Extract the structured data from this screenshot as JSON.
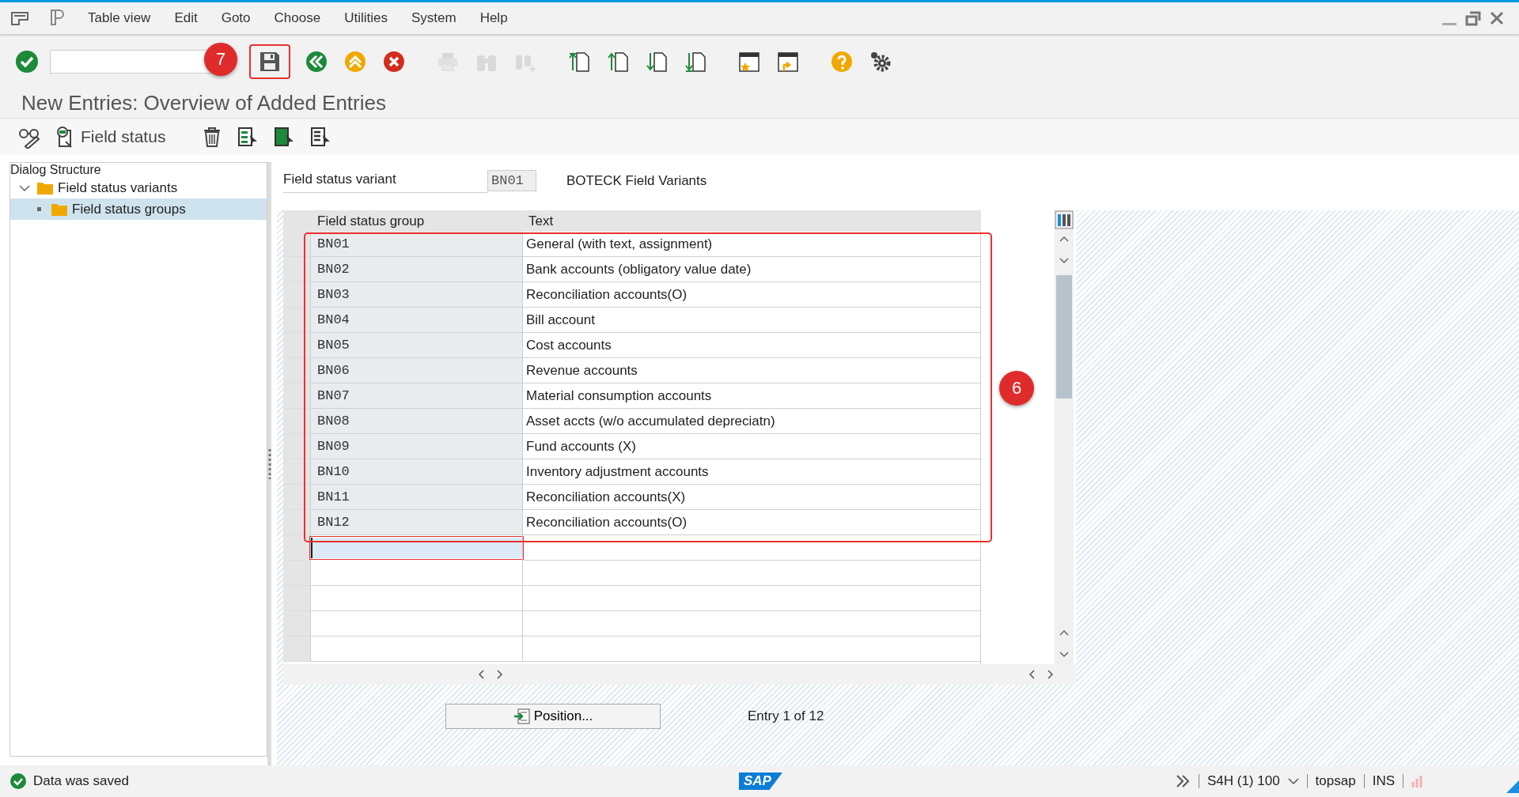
{
  "menu_bar": {
    "items": [
      {
        "label": "Table view"
      },
      {
        "label": "Edit"
      },
      {
        "label": "Goto"
      },
      {
        "label": "Choose"
      },
      {
        "label": "Utilities"
      },
      {
        "label": "System"
      },
      {
        "label": "Help"
      }
    ]
  },
  "toolbar": {
    "buttons": [
      {
        "kind": "enter",
        "disabled": false,
        "highlighted": false
      },
      {
        "kind": "command",
        "disabled": false,
        "highlighted": false
      },
      {
        "kind": "save",
        "disabled": false,
        "highlighted": true
      },
      {
        "kind": "back",
        "disabled": false,
        "highlighted": false
      },
      {
        "kind": "exit",
        "disabled": false,
        "highlighted": false
      },
      {
        "kind": "cancel",
        "disabled": false,
        "highlighted": false
      },
      {
        "kind": "print",
        "disabled": true,
        "highlighted": false
      },
      {
        "kind": "find",
        "disabled": true,
        "highlighted": false
      },
      {
        "kind": "findnext",
        "disabled": true,
        "highlighted": false
      },
      {
        "kind": "first",
        "disabled": false,
        "highlighted": false
      },
      {
        "kind": "prev",
        "disabled": false,
        "highlighted": false
      },
      {
        "kind": "next",
        "disabled": false,
        "highlighted": false
      },
      {
        "kind": "last",
        "disabled": false,
        "highlighted": false
      },
      {
        "kind": "session",
        "disabled": false,
        "highlighted": false
      },
      {
        "kind": "shortcut",
        "disabled": false,
        "highlighted": false
      },
      {
        "kind": "help",
        "disabled": false,
        "highlighted": false
      },
      {
        "kind": "settings",
        "disabled": false,
        "highlighted": false
      }
    ],
    "badge": "7"
  },
  "screen_title": "New Entries: Overview of Added Entries",
  "app_toolbar": {
    "buttons": [
      {
        "kind": "display_change"
      },
      {
        "kind": "field_status",
        "label": "Field status"
      },
      {
        "kind": "delete"
      },
      {
        "kind": "select_all"
      },
      {
        "kind": "select_block"
      },
      {
        "kind": "deselect"
      }
    ]
  },
  "dialog_structure": {
    "title": "Dialog Structure",
    "items": [
      {
        "label": "Field status variants",
        "expanded": true,
        "selected": false,
        "children": [
          {
            "label": "Field status groups",
            "selected": true
          }
        ]
      }
    ]
  },
  "header_field": {
    "label": "Field status variant",
    "value": "BN01",
    "description": "BOTECK Field Variants"
  },
  "table": {
    "columns": [
      "Field status group",
      "Text"
    ],
    "highlighted": true,
    "badge": "6",
    "rows": [
      {
        "group": "BN01",
        "text": "General (with text, assignment)"
      },
      {
        "group": "BN02",
        "text": "Bank accounts (obligatory value date)"
      },
      {
        "group": "BN03",
        "text": "Reconciliation accounts(O)"
      },
      {
        "group": "BN04",
        "text": "Bill account"
      },
      {
        "group": "BN05",
        "text": "Cost accounts"
      },
      {
        "group": "BN06",
        "text": "Revenue accounts"
      },
      {
        "group": "BN07",
        "text": "Material consumption accounts"
      },
      {
        "group": "BN08",
        "text": "Asset accts (w/o accumulated depreciatn)"
      },
      {
        "group": "BN09",
        "text": "Fund accounts (X)"
      },
      {
        "group": "BN10",
        "text": "Inventory adjustment accounts"
      },
      {
        "group": "BN11",
        "text": "Reconciliation accounts(X)"
      },
      {
        "group": "BN12",
        "text": "Reconciliation accounts(O)"
      }
    ]
  },
  "position_button": "Position...",
  "entry_counter": "Entry 1 of 12",
  "status_bar": {
    "message": {
      "kind": "success",
      "text": "Data was saved"
    },
    "logo": "SAP",
    "system": "S4H (1) 100",
    "user": "topsap",
    "mode": "INS"
  }
}
